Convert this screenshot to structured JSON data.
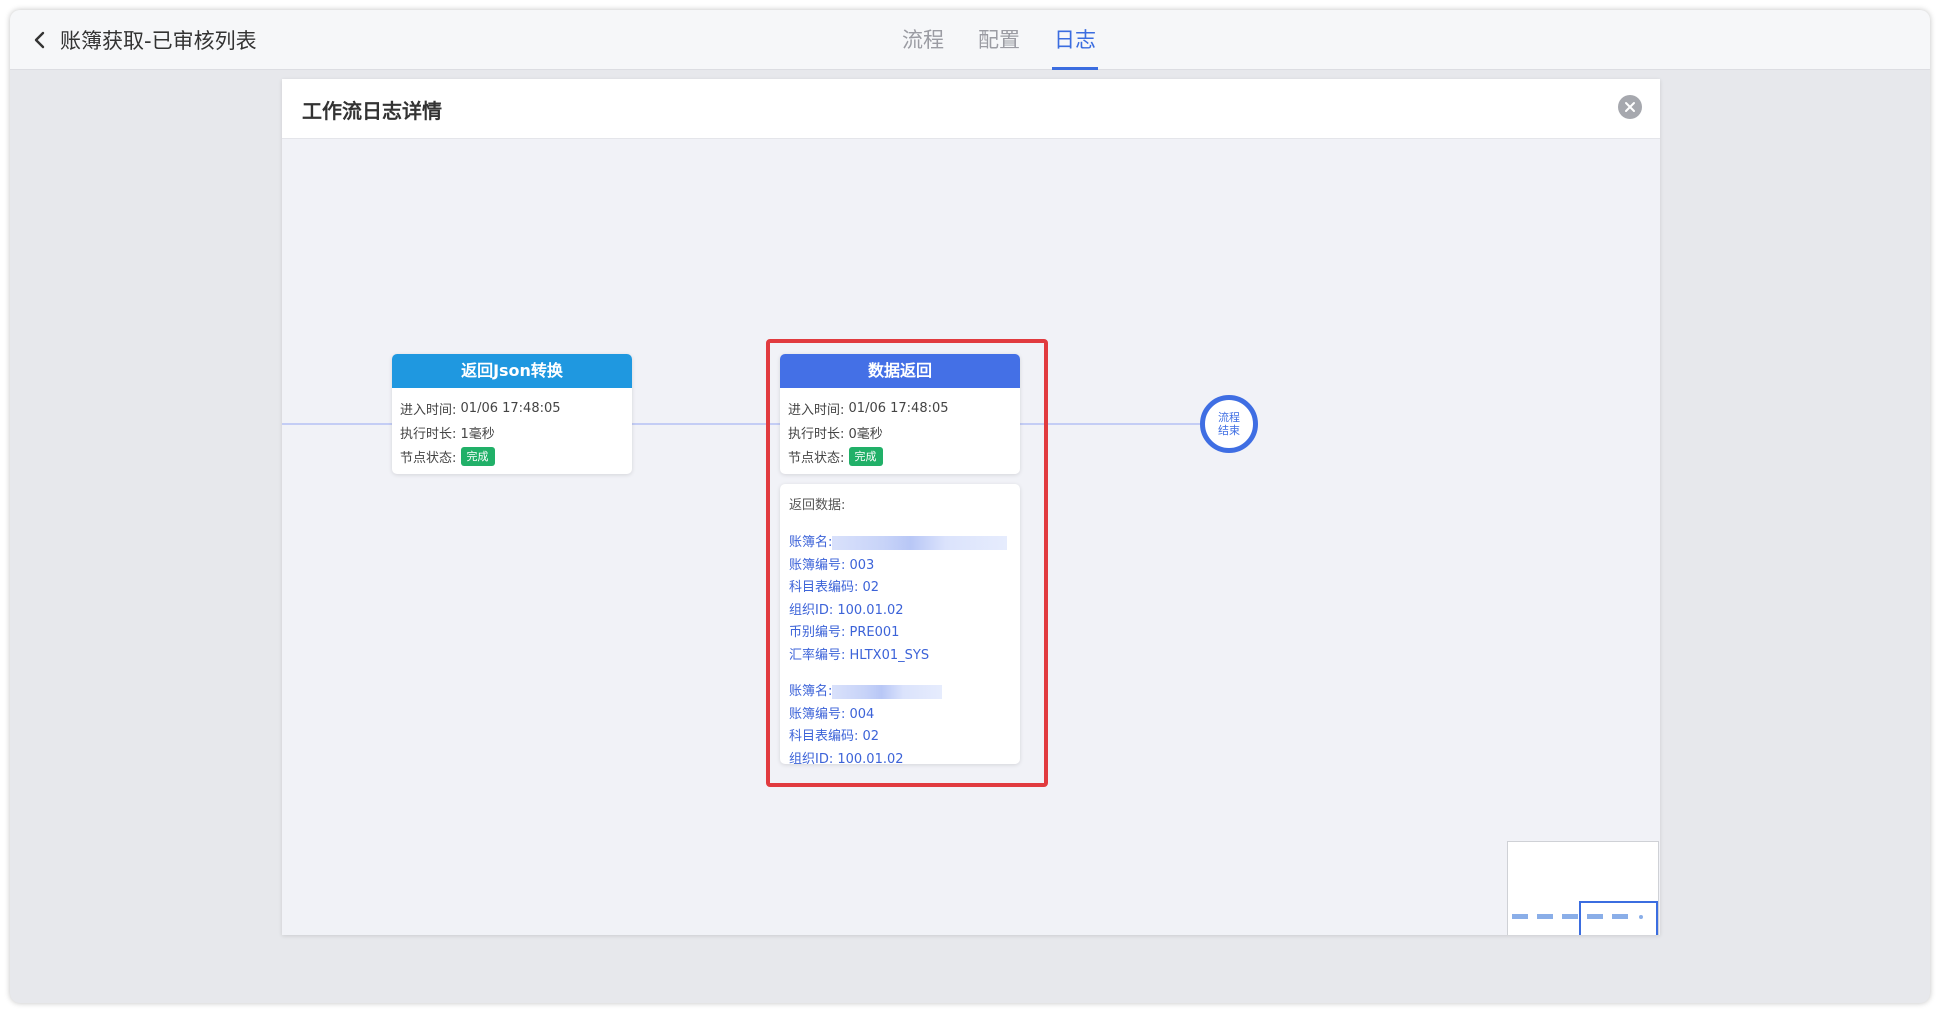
{
  "header": {
    "back_label": "账簿获取-已审核列表",
    "tabs": [
      {
        "label": "流程",
        "active": false
      },
      {
        "label": "配置",
        "active": false
      },
      {
        "label": "日志",
        "active": true
      }
    ]
  },
  "dialog": {
    "title": "工作流日志详情",
    "nodes": [
      {
        "title": "返回Json转换",
        "color": "#1f98e0",
        "enter_label": "进入时间:",
        "enter_time": "01/06 17:48:05",
        "duration_label": "执行时长:",
        "duration": "1毫秒",
        "status_label": "节点状态:",
        "status": "完成"
      },
      {
        "title": "数据返回",
        "color": "#4470e6",
        "enter_label": "进入时间:",
        "enter_time": "01/06 17:48:05",
        "duration_label": "执行时长:",
        "duration": "0毫秒",
        "status_label": "节点状态:",
        "status": "完成"
      }
    ],
    "end_node": {
      "line1": "流程",
      "line2": "结束"
    },
    "return_data": {
      "label": "返回数据:",
      "records": [
        {
          "name_label": "账簿名:",
          "book_no": "账簿编号: 003",
          "subject_code": "科目表编码: 02",
          "org_id": "组织ID: 100.01.02",
          "currency": "币别编号: PRE001",
          "rate": "汇率编号: HLTX01_SYS"
        },
        {
          "name_label": "账簿名:",
          "book_no": "账簿编号: 004",
          "subject_code": "科目表编码: 02",
          "org_id": "组织ID: 100.01.02"
        }
      ]
    }
  },
  "colors": {
    "accent": "#3b6de0",
    "status_done": "#21b068",
    "highlight": "#e13b3f"
  }
}
